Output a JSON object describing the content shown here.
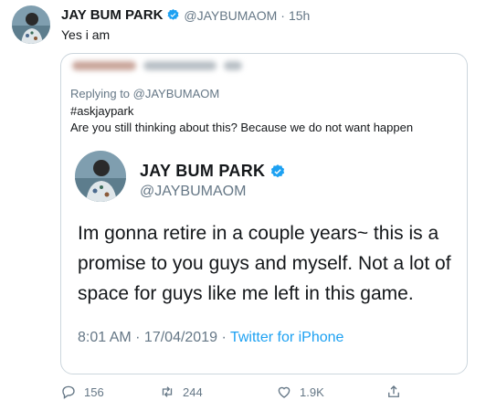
{
  "tweet": {
    "author_name": "JAY BUM PARK",
    "author_handle": "@JAYBUMAOM",
    "separator": "·",
    "time": "15h",
    "text": "Yes i am"
  },
  "quoted": {
    "replying_to": "Replying to @JAYBUMAOM",
    "lines": [
      "#askjaypark",
      "Are you still thinking about this?  Because we do not want happen"
    ],
    "inner": {
      "author_name": "JAY BUM PARK",
      "author_handle": "@JAYBUMAOM",
      "text": "Im gonna retire in a couple years~ this is a promise to you guys and myself.  Not a lot of space for guys like me left in this game.",
      "timestamp": "8:01 AM · 17/04/2019 · ",
      "source": "Twitter for iPhone"
    }
  },
  "actions": {
    "replies": "156",
    "retweets": "244",
    "likes": "1.9K"
  },
  "colors": {
    "accent": "#1da1f2",
    "secondary_text": "#657786",
    "border": "#ccd6dd"
  }
}
